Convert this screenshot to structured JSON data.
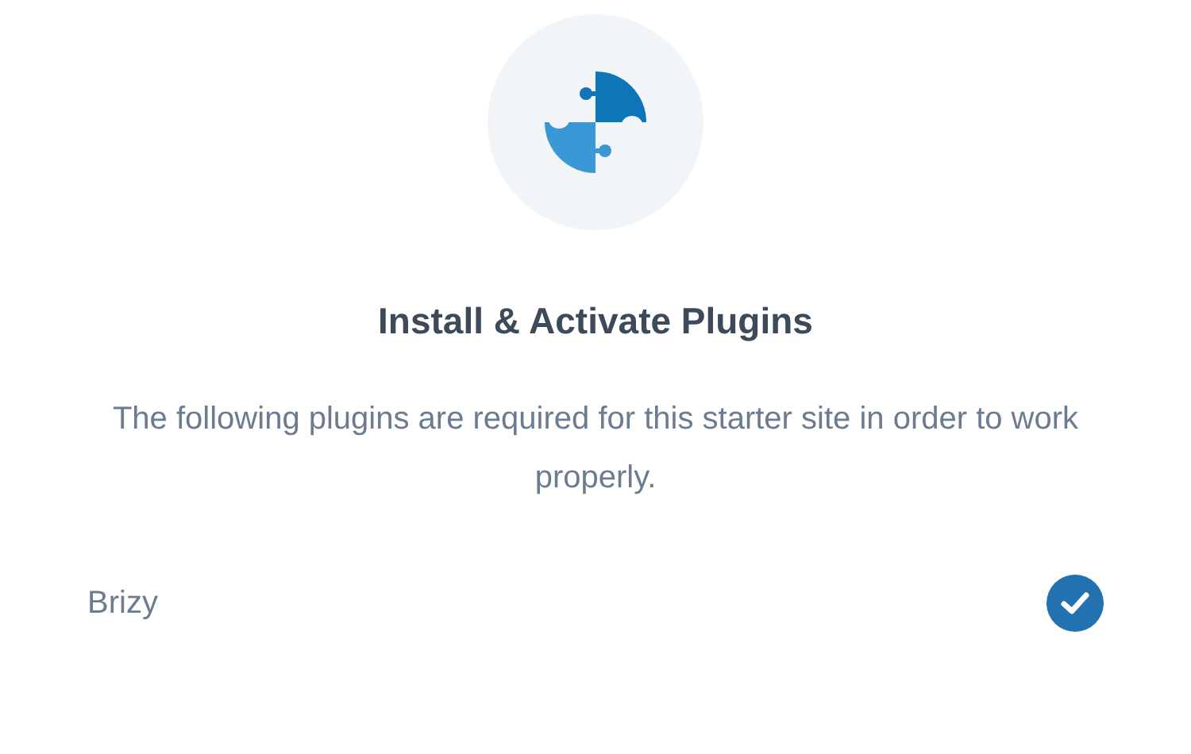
{
  "heading": "Install & Activate Plugins",
  "description": "The following plugins are required for this starter site in order to work properly.",
  "plugins": [
    {
      "name": "Brizy",
      "installed": true
    }
  ]
}
